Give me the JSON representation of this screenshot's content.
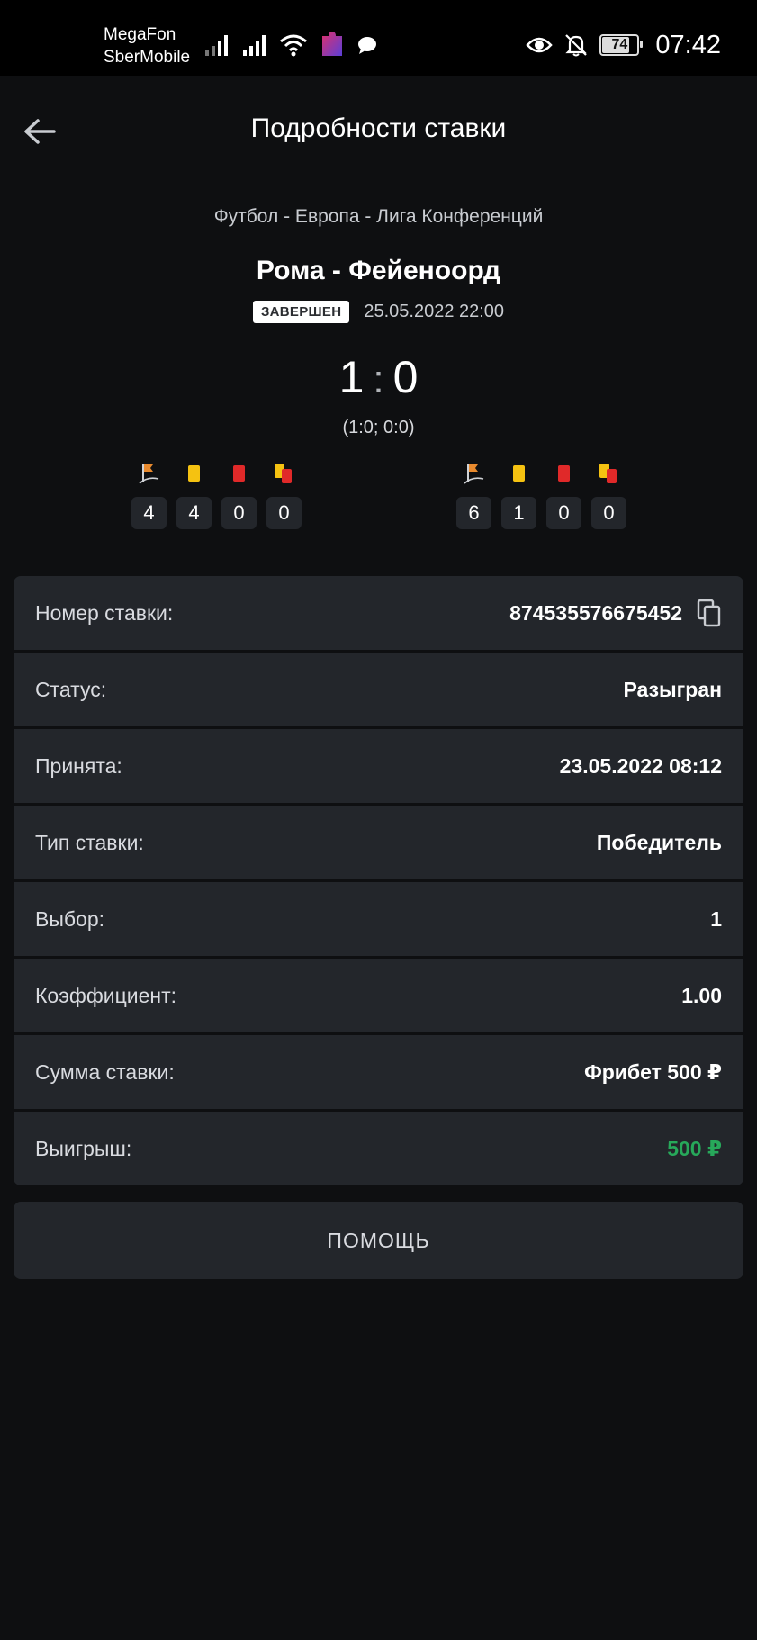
{
  "status_bar": {
    "carrier_1": "MegaFon",
    "carrier_2": "SberMobile",
    "battery": "74",
    "time": "07:42",
    "icons": [
      "signal-icon",
      "signal-icon",
      "wifi-icon",
      "app-icon",
      "message-icon",
      "eye-icon",
      "bell-off-icon",
      "battery-icon"
    ]
  },
  "header": {
    "title": "Подробности ставки",
    "back_icon": "arrow-left-icon"
  },
  "event": {
    "breadcrumb": "Футбол - Европа - Лига Конференций",
    "match": "Рома - Фейеноорд",
    "status_badge": "ЗАВЕРШЕН",
    "datetime": "25.05.2022 22:00",
    "score_home": "1",
    "score_sep": ":",
    "score_away": "0",
    "halves": "(1:0; 0:0)"
  },
  "stats": {
    "home": {
      "corners": "4",
      "yellow": "4",
      "red": "0",
      "yellow_red": "0"
    },
    "away": {
      "corners": "6",
      "yellow": "1",
      "red": "0",
      "yellow_red": "0"
    },
    "icons": [
      "corner-flag-icon",
      "yellow-card-icon",
      "red-card-icon",
      "second-yellow-card-icon"
    ],
    "colors": {
      "yellow": "#f5c211",
      "red": "#e02929",
      "flag": "#e88a2e"
    }
  },
  "details": {
    "bet_number_label": "Номер ставки:",
    "bet_number": "874535576675452",
    "status_label": "Статус:",
    "status": "Разыгран",
    "accepted_label": "Принята:",
    "accepted": "23.05.2022 08:12",
    "type_label": "Тип ставки:",
    "type": "Победитель",
    "choice_label": "Выбор:",
    "choice": "1",
    "odds_label": "Коэффициент:",
    "odds": "1.00",
    "stake_label": "Сумма ставки:",
    "stake": "Фрибет 500 ₽",
    "win_label": "Выигрыш:",
    "win": "500 ₽"
  },
  "help_button": "ПОМОЩЬ",
  "colors": {
    "background": "#0e0f11",
    "row": "#23262b",
    "win": "#27a85a"
  }
}
